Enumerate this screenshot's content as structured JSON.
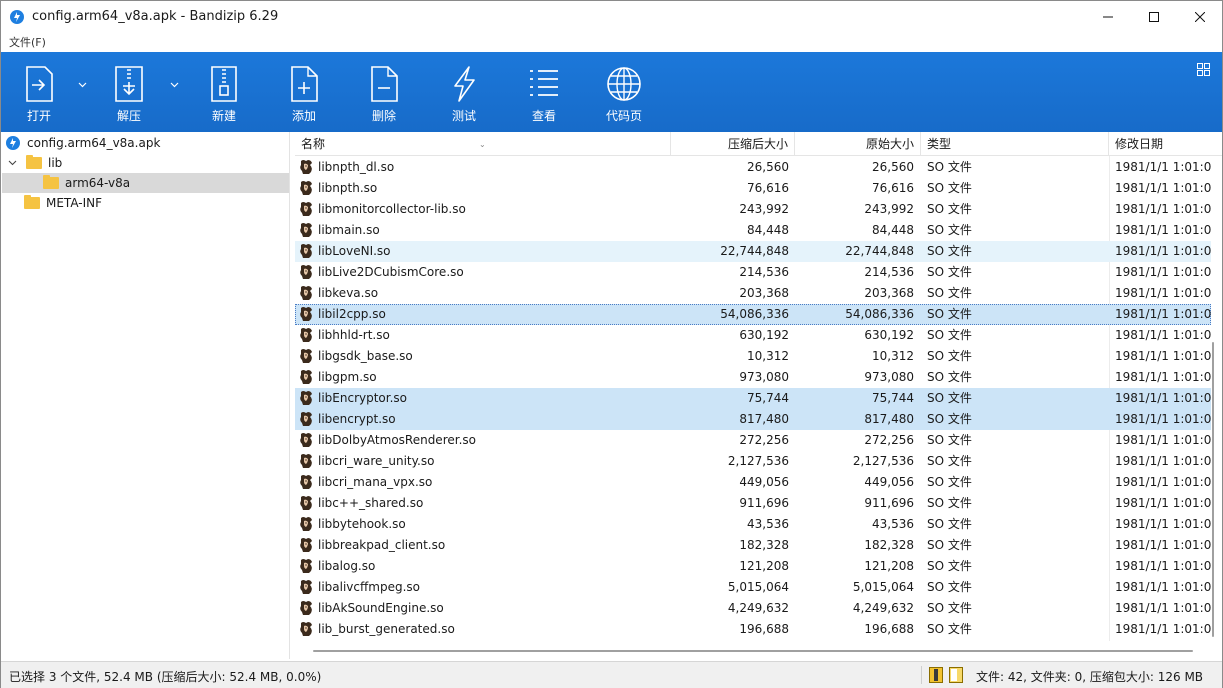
{
  "window": {
    "title": "config.arm64_v8a.apk - Bandizip 6.29",
    "minimize_icon": "minimize-icon",
    "maximize_icon": "maximize-icon",
    "close_icon": "close-icon"
  },
  "menu": {
    "file": "文件(F)"
  },
  "toolbar": {
    "open": "打开",
    "extract": "解压",
    "new": "新建",
    "add": "添加",
    "delete": "删除",
    "test": "测试",
    "view": "查看",
    "codepage": "代码页"
  },
  "tree": {
    "root": "config.arm64_v8a.apk",
    "lib": "lib",
    "arm64": "arm64-v8a",
    "meta": "META-INF"
  },
  "columns": {
    "name": "名称",
    "compressed": "压缩后大小",
    "original": "原始大小",
    "type": "类型",
    "modified": "修改日期"
  },
  "rows": [
    {
      "name": "libnpth_dl.so",
      "comp": "26,560",
      "orig": "26,560",
      "type": "SO 文件",
      "date": "1981/1/1 1:01:0",
      "state": ""
    },
    {
      "name": "libnpth.so",
      "comp": "76,616",
      "orig": "76,616",
      "type": "SO 文件",
      "date": "1981/1/1 1:01:0",
      "state": ""
    },
    {
      "name": "libmonitorcollector-lib.so",
      "comp": "243,992",
      "orig": "243,992",
      "type": "SO 文件",
      "date": "1981/1/1 1:01:0",
      "state": ""
    },
    {
      "name": "libmain.so",
      "comp": "84,448",
      "orig": "84,448",
      "type": "SO 文件",
      "date": "1981/1/1 1:01:0",
      "state": ""
    },
    {
      "name": "libLoveNI.so",
      "comp": "22,744,848",
      "orig": "22,744,848",
      "type": "SO 文件",
      "date": "1981/1/1 1:01:0",
      "state": "hl"
    },
    {
      "name": "libLive2DCubismCore.so",
      "comp": "214,536",
      "orig": "214,536",
      "type": "SO 文件",
      "date": "1981/1/1 1:01:0",
      "state": ""
    },
    {
      "name": "libkeva.so",
      "comp": "203,368",
      "orig": "203,368",
      "type": "SO 文件",
      "date": "1981/1/1 1:01:0",
      "state": ""
    },
    {
      "name": "libil2cpp.so",
      "comp": "54,086,336",
      "orig": "54,086,336",
      "type": "SO 文件",
      "date": "1981/1/1 1:01:0",
      "state": "sel focus"
    },
    {
      "name": "libhhld-rt.so",
      "comp": "630,192",
      "orig": "630,192",
      "type": "SO 文件",
      "date": "1981/1/1 1:01:0",
      "state": ""
    },
    {
      "name": "libgsdk_base.so",
      "comp": "10,312",
      "orig": "10,312",
      "type": "SO 文件",
      "date": "1981/1/1 1:01:0",
      "state": ""
    },
    {
      "name": "libgpm.so",
      "comp": "973,080",
      "orig": "973,080",
      "type": "SO 文件",
      "date": "1981/1/1 1:01:0",
      "state": ""
    },
    {
      "name": "libEncryptor.so",
      "comp": "75,744",
      "orig": "75,744",
      "type": "SO 文件",
      "date": "1981/1/1 1:01:0",
      "state": "sel"
    },
    {
      "name": "libencrypt.so",
      "comp": "817,480",
      "orig": "817,480",
      "type": "SO 文件",
      "date": "1981/1/1 1:01:0",
      "state": "sel"
    },
    {
      "name": "libDolbyAtmosRenderer.so",
      "comp": "272,256",
      "orig": "272,256",
      "type": "SO 文件",
      "date": "1981/1/1 1:01:0",
      "state": ""
    },
    {
      "name": "libcri_ware_unity.so",
      "comp": "2,127,536",
      "orig": "2,127,536",
      "type": "SO 文件",
      "date": "1981/1/1 1:01:0",
      "state": ""
    },
    {
      "name": "libcri_mana_vpx.so",
      "comp": "449,056",
      "orig": "449,056",
      "type": "SO 文件",
      "date": "1981/1/1 1:01:0",
      "state": ""
    },
    {
      "name": "libc++_shared.so",
      "comp": "911,696",
      "orig": "911,696",
      "type": "SO 文件",
      "date": "1981/1/1 1:01:0",
      "state": ""
    },
    {
      "name": "libbytehook.so",
      "comp": "43,536",
      "orig": "43,536",
      "type": "SO 文件",
      "date": "1981/1/1 1:01:0",
      "state": ""
    },
    {
      "name": "libbreakpad_client.so",
      "comp": "182,328",
      "orig": "182,328",
      "type": "SO 文件",
      "date": "1981/1/1 1:01:0",
      "state": ""
    },
    {
      "name": "libalog.so",
      "comp": "121,208",
      "orig": "121,208",
      "type": "SO 文件",
      "date": "1981/1/1 1:01:0",
      "state": ""
    },
    {
      "name": "libalivcffmpeg.so",
      "comp": "5,015,064",
      "orig": "5,015,064",
      "type": "SO 文件",
      "date": "1981/1/1 1:01:0",
      "state": ""
    },
    {
      "name": "libAkSoundEngine.so",
      "comp": "4,249,632",
      "orig": "4,249,632",
      "type": "SO 文件",
      "date": "1981/1/1 1:01:0",
      "state": ""
    },
    {
      "name": "lib_burst_generated.so",
      "comp": "196,688",
      "orig": "196,688",
      "type": "SO 文件",
      "date": "1981/1/1 1:01:0",
      "state": ""
    }
  ],
  "status": {
    "left": "已选择 3 个文件, 52.4 MB (压缩后大小: 52.4 MB, 0.0%)",
    "right": "文件: 42, 文件夹: 0, 压缩包大小: 126 MB"
  },
  "colors": {
    "toolbar": "#1a73d4",
    "selection": "#cce4f7",
    "hover": "#e5f3fb"
  }
}
